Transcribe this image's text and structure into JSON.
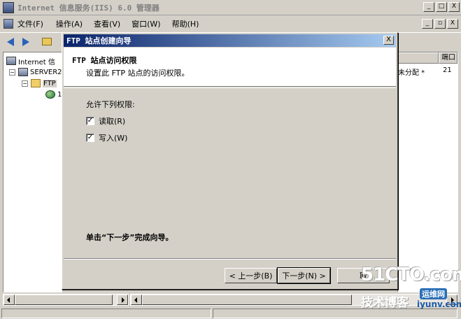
{
  "window": {
    "title": "Internet 信息服务(IIS) 6.0 管理器",
    "buttons": {
      "minimize": "_",
      "maximize": "□",
      "close": "X"
    }
  },
  "menubar": {
    "items": [
      "文件(F)",
      "操作(A)",
      "查看(V)",
      "窗口(W)",
      "帮助(H)"
    ],
    "child_buttons": {
      "minimize": "_",
      "restore": "▫",
      "close": "X"
    }
  },
  "tree": {
    "root": "Internet 信",
    "server": "SERVER2",
    "ftp": "FTP",
    "child_fragment": "1"
  },
  "list": {
    "column_port": "端口",
    "cell_assign": "未分配 *",
    "cell_port": "21"
  },
  "dialog": {
    "title": "FTP 站点创建向导",
    "close": "X",
    "header_title": "FTP 站点访问权限",
    "header_subtitle": "设置此 FTP 站点的访问权限。",
    "permissions_label": "允许下列权限:",
    "permissions": [
      {
        "label": "读取(R)",
        "checked": true
      },
      {
        "label": "写入(W)",
        "checked": true
      }
    ],
    "finish_note": "单击“下一步”完成向导。",
    "buttons": {
      "back": "< 上一步(B)",
      "next": "下一步(N) >",
      "cancel": "取"
    }
  },
  "watermark": {
    "logo": "51CTO.com",
    "sub": "技术博客",
    "site": "iyunv.com",
    "badge": "运维网"
  },
  "colors": {
    "dialog_title_start": "#0a246a",
    "dialog_title_end": "#a6caf0",
    "face": "#d4d0c8"
  }
}
